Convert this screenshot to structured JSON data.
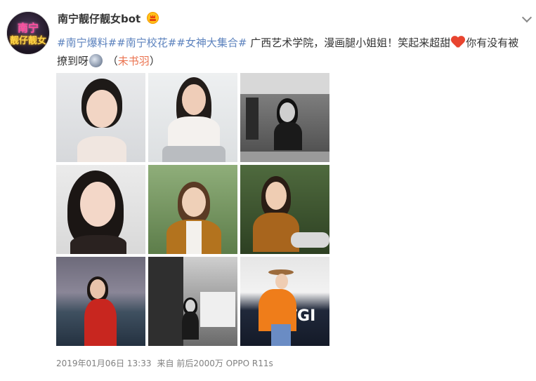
{
  "user": {
    "name": "南宁靓仔靓女bot",
    "avatar_text_top": "南宁",
    "avatar_text_bottom": "靓仔靓女",
    "badge_icon": "vip-crown-icon"
  },
  "post": {
    "tags": [
      "#南宁爆料#",
      "#南宁校花#",
      "#女神大集合#"
    ],
    "text_before_heart": " 广西艺术学院，漫画腿小姐姐！笑起来超甜",
    "text_after_heart": "你有没有被撩到呀",
    "paren_open": " （",
    "author": "未书羽",
    "paren_close": "）",
    "emoji_icons": [
      "red-heart-icon",
      "shocked-face-icon"
    ]
  },
  "photos": [
    {
      "label": "photo-1",
      "theme": "studio-portrait"
    },
    {
      "label": "photo-2",
      "theme": "studio-chair"
    },
    {
      "label": "photo-3",
      "theme": "cafe-monochrome"
    },
    {
      "label": "photo-4",
      "theme": "studio-closeup"
    },
    {
      "label": "photo-5",
      "theme": "park-cardigan"
    },
    {
      "label": "photo-6",
      "theme": "park-scooter"
    },
    {
      "label": "photo-7",
      "theme": "seaside-red"
    },
    {
      "label": "photo-8",
      "theme": "street-monochrome"
    },
    {
      "label": "photo-9",
      "theme": "runway-orange"
    }
  ],
  "footer": {
    "timestamp": "2019年01月06日 13:33",
    "source_prefix": "来自",
    "source": "前后2000万 OPPO R11s"
  },
  "colors": {
    "tag": "#5d83be",
    "author_link": "#eb7350",
    "meta": "#808080"
  }
}
